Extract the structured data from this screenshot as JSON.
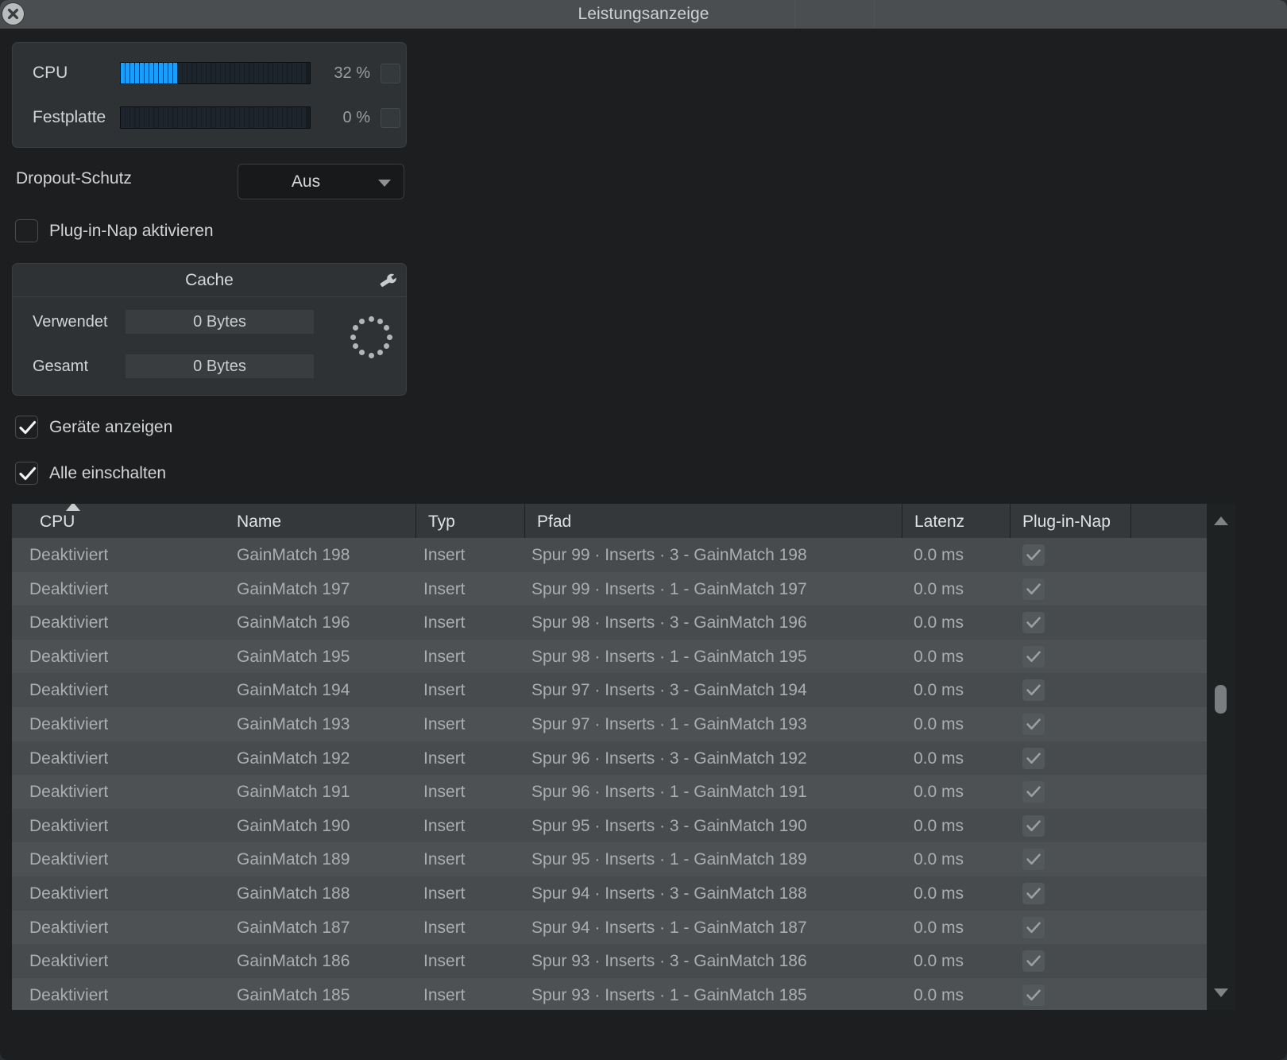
{
  "window": {
    "title": "Leistungsanzeige",
    "close_icon": "close-icon"
  },
  "meters": {
    "rows": [
      {
        "label": "CPU",
        "value": "32 %",
        "percent": 32
      },
      {
        "label": "Festplatte",
        "value": "0 %",
        "percent": 0
      }
    ]
  },
  "dropout": {
    "label": "Dropout-Schutz",
    "value": "Aus",
    "options": [
      "Aus"
    ]
  },
  "plugin_nap_checkbox": {
    "label": "Plug-in-Nap aktivieren",
    "checked": false
  },
  "cache": {
    "title": "Cache",
    "wrench_icon": "wrench-icon",
    "spinner_icon": "spinner-icon",
    "rows": [
      {
        "label": "Verwendet",
        "value": "0 Bytes"
      },
      {
        "label": "Gesamt",
        "value": "0 Bytes"
      }
    ]
  },
  "options": [
    {
      "label": "Geräte anzeigen",
      "checked": true
    },
    {
      "label": "Alle einschalten",
      "checked": true
    }
  ],
  "table": {
    "columns": [
      "CPU",
      "Name",
      "Typ",
      "Pfad",
      "Latenz",
      "Plug-in-Nap",
      ""
    ],
    "sort_column": "CPU",
    "sort_direction": "ascending",
    "rows": [
      {
        "cpu": "Deaktiviert",
        "name": "GainMatch 198",
        "typ": "Insert",
        "pfad": "Spur 99 · Inserts · 3 - GainMatch 198",
        "latenz": "0.0 ms",
        "nap": true
      },
      {
        "cpu": "Deaktiviert",
        "name": "GainMatch 197",
        "typ": "Insert",
        "pfad": "Spur 99 · Inserts · 1 - GainMatch 197",
        "latenz": "0.0 ms",
        "nap": true
      },
      {
        "cpu": "Deaktiviert",
        "name": "GainMatch 196",
        "typ": "Insert",
        "pfad": "Spur 98 · Inserts · 3 - GainMatch 196",
        "latenz": "0.0 ms",
        "nap": true
      },
      {
        "cpu": "Deaktiviert",
        "name": "GainMatch 195",
        "typ": "Insert",
        "pfad": "Spur 98 · Inserts · 1 - GainMatch 195",
        "latenz": "0.0 ms",
        "nap": true
      },
      {
        "cpu": "Deaktiviert",
        "name": "GainMatch 194",
        "typ": "Insert",
        "pfad": "Spur 97 · Inserts · 3 - GainMatch 194",
        "latenz": "0.0 ms",
        "nap": true
      },
      {
        "cpu": "Deaktiviert",
        "name": "GainMatch 193",
        "typ": "Insert",
        "pfad": "Spur 97 · Inserts · 1 - GainMatch 193",
        "latenz": "0.0 ms",
        "nap": true
      },
      {
        "cpu": "Deaktiviert",
        "name": "GainMatch 192",
        "typ": "Insert",
        "pfad": "Spur 96 · Inserts · 3 - GainMatch 192",
        "latenz": "0.0 ms",
        "nap": true
      },
      {
        "cpu": "Deaktiviert",
        "name": "GainMatch 191",
        "typ": "Insert",
        "pfad": "Spur 96 · Inserts · 1 - GainMatch 191",
        "latenz": "0.0 ms",
        "nap": true
      },
      {
        "cpu": "Deaktiviert",
        "name": "GainMatch 190",
        "typ": "Insert",
        "pfad": "Spur 95 · Inserts · 3 - GainMatch 190",
        "latenz": "0.0 ms",
        "nap": true
      },
      {
        "cpu": "Deaktiviert",
        "name": "GainMatch 189",
        "typ": "Insert",
        "pfad": "Spur 95 · Inserts · 1 - GainMatch 189",
        "latenz": "0.0 ms",
        "nap": true
      },
      {
        "cpu": "Deaktiviert",
        "name": "GainMatch 188",
        "typ": "Insert",
        "pfad": "Spur 94 · Inserts · 3 - GainMatch 188",
        "latenz": "0.0 ms",
        "nap": true
      },
      {
        "cpu": "Deaktiviert",
        "name": "GainMatch 187",
        "typ": "Insert",
        "pfad": "Spur 94 · Inserts · 1 - GainMatch 187",
        "latenz": "0.0 ms",
        "nap": true
      },
      {
        "cpu": "Deaktiviert",
        "name": "GainMatch 186",
        "typ": "Insert",
        "pfad": "Spur 93 · Inserts · 3 - GainMatch 186",
        "latenz": "0.0 ms",
        "nap": true
      },
      {
        "cpu": "Deaktiviert",
        "name": "GainMatch 185",
        "typ": "Insert",
        "pfad": "Spur 93 · Inserts · 1 - GainMatch 185",
        "latenz": "0.0 ms",
        "nap": true
      }
    ]
  },
  "scrollbar": {
    "up_icon": "caret-up-icon",
    "down_icon": "caret-down-icon",
    "thumb": "scrollbar-thumb"
  },
  "colors": {
    "meter_active": "#1b9dfa",
    "titlebar": "#4a4e50",
    "window_bg": "#1c1e1f",
    "table_row": "#4a4e50"
  }
}
